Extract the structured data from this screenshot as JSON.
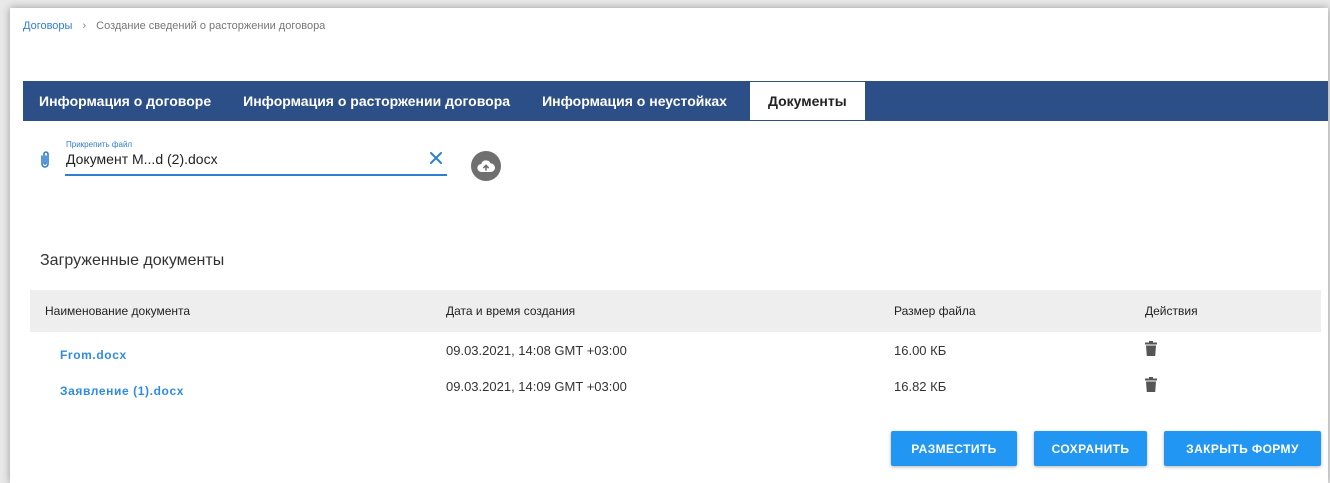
{
  "breadcrumb": {
    "root": "Договоры",
    "separator": "›",
    "current": "Создание сведений о расторжении договора"
  },
  "tabs": [
    {
      "label": "Информация о договоре"
    },
    {
      "label": "Информация о расторжении договора"
    },
    {
      "label": "Информация о неустойках"
    },
    {
      "label": "Документы",
      "active": true
    }
  ],
  "attach": {
    "label": "Прикрепить файл",
    "value": "Документ M...d (2).docx"
  },
  "uploaded": {
    "title": "Загруженные документы",
    "columns": [
      "Наименование документа",
      "Дата и время создания",
      "Размер файла",
      "Действия"
    ],
    "rows": [
      {
        "name": "From.docx",
        "created": "09.03.2021, 14:08 GMT +03:00",
        "size": "16.00 КБ"
      },
      {
        "name": "Заявление (1).docx",
        "created": "09.03.2021, 14:09 GMT +03:00",
        "size": "16.82 КБ"
      }
    ]
  },
  "buttons": {
    "publish": "РАЗМЕСТИТЬ",
    "save": "СОХРАНИТЬ",
    "close": "ЗАКРЫТЬ ФОРМУ"
  },
  "colors": {
    "tabbar": "#2d4f88",
    "accent": "#2196f3",
    "link": "#2f8be0"
  },
  "icons": {
    "attach": "paperclip-icon",
    "clear": "close-icon",
    "upload": "cloud-upload-icon",
    "delete": "trash-icon"
  }
}
